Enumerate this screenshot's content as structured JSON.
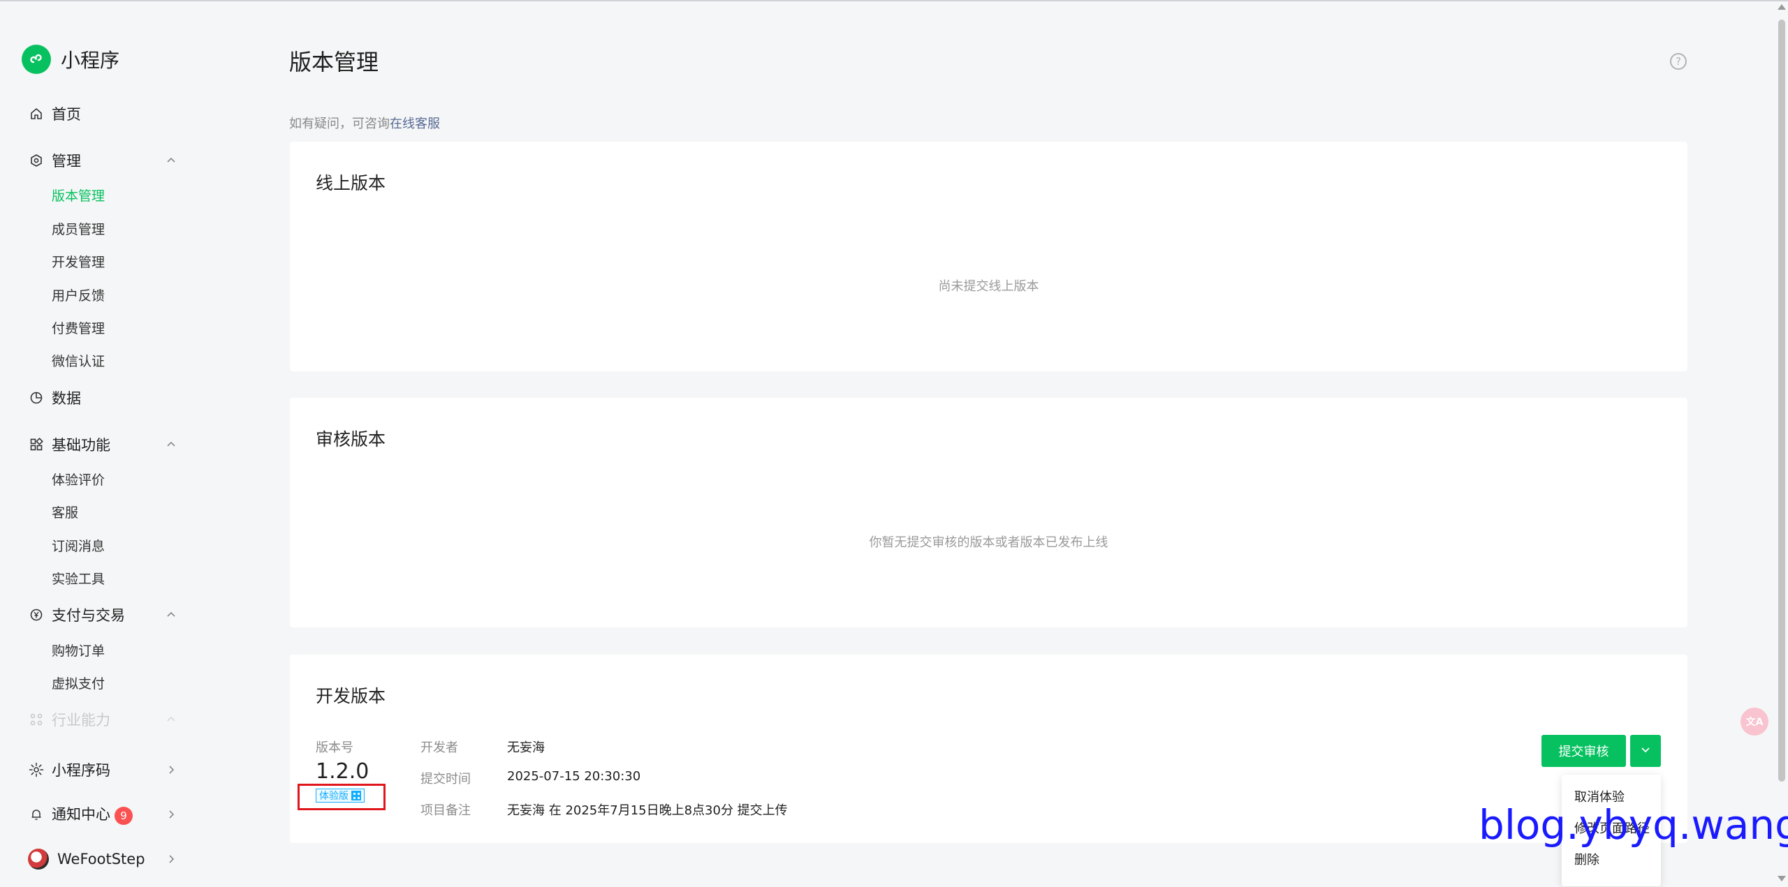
{
  "app": {
    "name": "小程序"
  },
  "sidebar": {
    "home": "首页",
    "manage": {
      "label": "管理",
      "items": [
        "版本管理",
        "成员管理",
        "开发管理",
        "用户反馈",
        "付费管理",
        "微信认证"
      ]
    },
    "data": "数据",
    "basic": {
      "label": "基础功能",
      "items": [
        "体验评价",
        "客服",
        "订阅消息",
        "实验工具"
      ]
    },
    "pay": {
      "label": "支付与交易",
      "items": [
        "购物订单",
        "虚拟支付"
      ]
    },
    "industry": "行业能力",
    "qrcode": "小程序码",
    "notify": {
      "label": "通知中心",
      "count": "9"
    },
    "account": "WeFootStep"
  },
  "main": {
    "title": "版本管理",
    "hint_prefix": "如有疑问，可咨询",
    "hint_link": "在线客服",
    "online": {
      "title": "线上版本",
      "empty": "尚未提交线上版本"
    },
    "review": {
      "title": "审核版本",
      "empty": "你暂无提交审核的版本或者版本已发布上线"
    },
    "dev": {
      "title": "开发版本",
      "version_label": "版本号",
      "version": "1.2.0",
      "tag": "体验版",
      "developer_label": "开发者",
      "developer": "无妄海",
      "time_label": "提交时间",
      "time": "2025-07-15 20:30:30",
      "note_label": "项目备注",
      "note": "无妄海 在 2025年7月15日晚上8点30分 提交上传",
      "submit": "提交审核",
      "menu": [
        "取消体验",
        "修改页面路径",
        "删除"
      ]
    }
  },
  "watermark": "blog.ybyq.wang",
  "colors": {
    "brand": "#07c160",
    "link": "#576b95",
    "badge": "#fa5151",
    "annotation": "#e0161c"
  }
}
